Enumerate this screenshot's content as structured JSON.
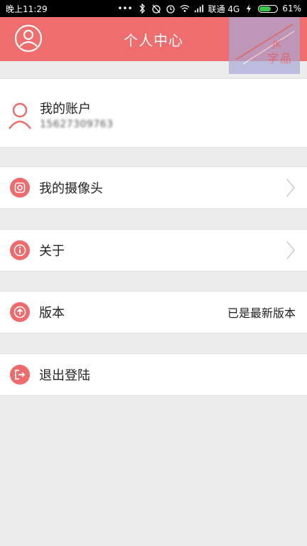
{
  "status_bar": {
    "time": "晚上11:29",
    "dots": "•••",
    "carrier": "联通 4G",
    "battery_text": "61%",
    "icons": [
      "bluetooth-icon",
      "alarm-off-icon",
      "alarm-icon",
      "wifi-icon",
      "signal-icon",
      "charging-icon",
      "battery-icon"
    ]
  },
  "header": {
    "title": "个人中心",
    "avatar_icon": "user-avatar-icon",
    "watermark_icon": "watermark-logo-icon"
  },
  "account": {
    "name": "我的账户",
    "phone": "15627309763",
    "icon": "user-outline-icon"
  },
  "menu": {
    "cameras": {
      "label": "我的摄像头",
      "icon": "camera-icon"
    },
    "about": {
      "label": "关于",
      "icon": "info-icon"
    },
    "version": {
      "label": "版本",
      "value": "已是最新版本",
      "icon": "upload-icon"
    },
    "logout": {
      "label": "退出登陆",
      "icon": "logout-icon"
    }
  },
  "colors": {
    "accent": "#f06d6d",
    "background": "#ececec",
    "card": "#ffffff",
    "battery_fill": "#38c74b"
  }
}
